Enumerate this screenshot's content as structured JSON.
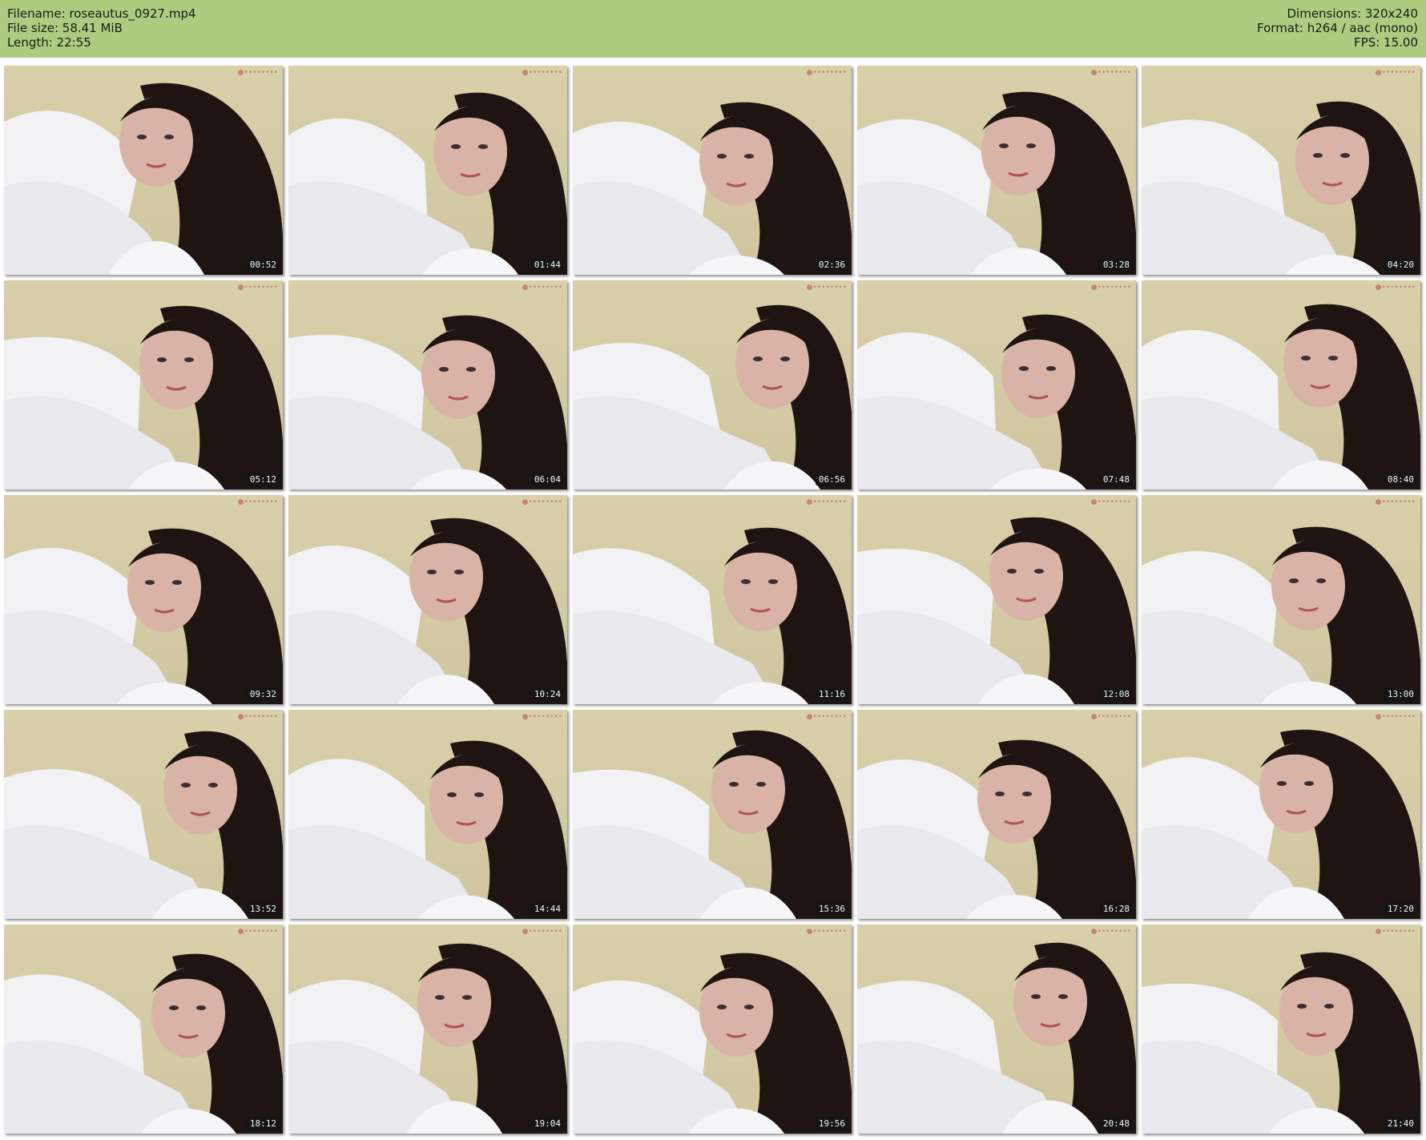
{
  "header": {
    "filename_line": "Filename: roseautus_0927.mp4",
    "filesize_line": "File size: 58.41 MiB",
    "length_line": "Length: 22:55",
    "dimensions_line": "Dimensions: 320x240",
    "format_line": "Format: h264 / aac (mono)",
    "fps_line": "FPS: 15.00"
  },
  "colors": {
    "header_background": "#adcc7f",
    "timestamp_background": "#141414",
    "wall_tint": "#d8d0a8",
    "fabric_white": "#f2f2f4",
    "hair_dark": "#1e1412",
    "skin": "#d9b4a6"
  },
  "frames": [
    {
      "time": "00:52"
    },
    {
      "time": "01:44"
    },
    {
      "time": "02:36"
    },
    {
      "time": "03:28"
    },
    {
      "time": "04:20"
    },
    {
      "time": "05:12"
    },
    {
      "time": "06:04"
    },
    {
      "time": "06:56"
    },
    {
      "time": "07:48"
    },
    {
      "time": "08:40"
    },
    {
      "time": "09:32"
    },
    {
      "time": "10:24"
    },
    {
      "time": "11:16"
    },
    {
      "time": "12:08"
    },
    {
      "time": "13:00"
    },
    {
      "time": "13:52"
    },
    {
      "time": "14:44"
    },
    {
      "time": "15:36"
    },
    {
      "time": "16:28"
    },
    {
      "time": "17:20"
    },
    {
      "time": "18:12"
    },
    {
      "time": "19:04"
    },
    {
      "time": "19:56"
    },
    {
      "time": "20:48"
    },
    {
      "time": "21:40"
    }
  ]
}
